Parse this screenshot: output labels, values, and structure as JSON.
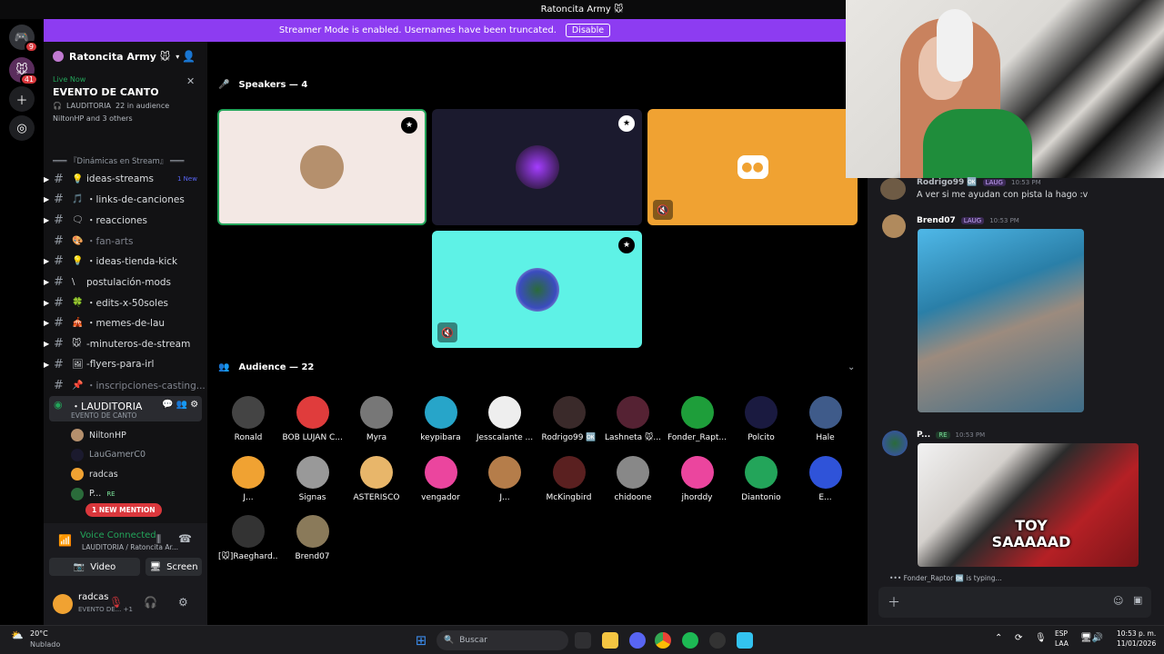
{
  "window": {
    "title": "Ratoncita Army 🐭"
  },
  "banner": {
    "text": "Streamer Mode is enabled. Usernames have been truncated.",
    "button": "Disable"
  },
  "servers": {
    "home_badge": "9",
    "server_badge": "41"
  },
  "sidebar": {
    "server_name": "Ratoncita Army 🐭",
    "live": {
      "status": "Live Now",
      "event": "EVENTO DE CANTO",
      "meta_channel": "LAUDITORIA",
      "meta_audience": "22 in audience",
      "attendees": "NiltonHP and 3 others"
    },
    "category": "═══ 『Dinámicas en Stream』 ═══",
    "channels": [
      {
        "emoji": "💡",
        "label": "ideas-streams",
        "badge": "1 New"
      },
      {
        "emoji": "🎵",
        "label": "・links-de-canciones"
      },
      {
        "emoji": "🗨",
        "label": "・reacciones"
      },
      {
        "emoji": "🎨",
        "label": "・fan-arts",
        "muted": true
      },
      {
        "emoji": "💡",
        "label": "・ideas-tienda-kick"
      },
      {
        "emoji": "\\",
        "label": "postulación-mods"
      },
      {
        "emoji": "🍀",
        "label": "・edits-x-50soles"
      },
      {
        "emoji": "🎪",
        "label": "・memes-de-lau"
      },
      {
        "emoji": "🐭",
        "label": "-minuteros-de-stream"
      },
      {
        "emoji": "🖼",
        "label": "-flyers-para-irl"
      },
      {
        "emoji": "📌",
        "label": "・inscripciones-casting...",
        "muted": true
      }
    ],
    "voice_channel": {
      "label": "・LAUDITORIA",
      "sub": "EVENTO DE CANTO"
    },
    "voice_users": [
      {
        "name": "NiltonHP"
      },
      {
        "name": "LauGamerC0",
        "muted": true
      },
      {
        "name": "radcas"
      },
      {
        "name": "P...",
        "tag": "RE"
      }
    ],
    "mention_pill": "1 NEW MENTION",
    "voice_connected": {
      "status": "Voice Connected",
      "location": "LAUDITORIA / Ratoncita Ar..."
    },
    "video_button": "Video",
    "screen_button": "Screen",
    "self": {
      "name": "radcas",
      "status": "EVENTO DE... +1"
    }
  },
  "stage": {
    "speakers_header": "Speakers — 4",
    "audience_header": "Audience — 22",
    "audience": [
      "Ronald",
      "BOB LUJAN C...",
      "Myra",
      "keypibara",
      "Jesscalante ...",
      "Rodrigo99 🆗",
      "Lashneta 🐭...",
      "Fonder_Rapt...",
      "Polcito",
      "Hale",
      "J...",
      "Signas",
      "ASTERISCO",
      "vengador",
      "J...",
      "McKingbird",
      "chidoone",
      "jhorddy",
      "Diantonio",
      "E...",
      "[🐭]Raeghard...",
      "Brend07"
    ]
  },
  "chat": {
    "messages": [
      {
        "author": "Rodrigo99 🆗",
        "tag": "LAUG",
        "time": "10:53 PM",
        "text": "A ver si me ayudan con pista la hago :v"
      },
      {
        "author": "Brend07",
        "tag": "LAUG",
        "time": "10:53 PM",
        "text": ""
      },
      {
        "author": "P...",
        "tag": "RE",
        "time": "10:53 PM",
        "text": ""
      }
    ],
    "gif_caption": "TOY SAAAAAD",
    "typing": "Fonder_Raptor 🆗 is typing..."
  },
  "taskbar": {
    "weather_temp": "20°C",
    "weather_text": "Nublado",
    "search_placeholder": "Buscar",
    "lang": "ESP",
    "lang2": "LAA",
    "time": "10:53 p. m.",
    "date": "11/01/2026"
  },
  "colors": {
    "accent": "#8d3cf1",
    "discord": "#5865f2",
    "green": "#23a55a",
    "orange": "#f0a232",
    "cyan": "#5ef2e6"
  }
}
